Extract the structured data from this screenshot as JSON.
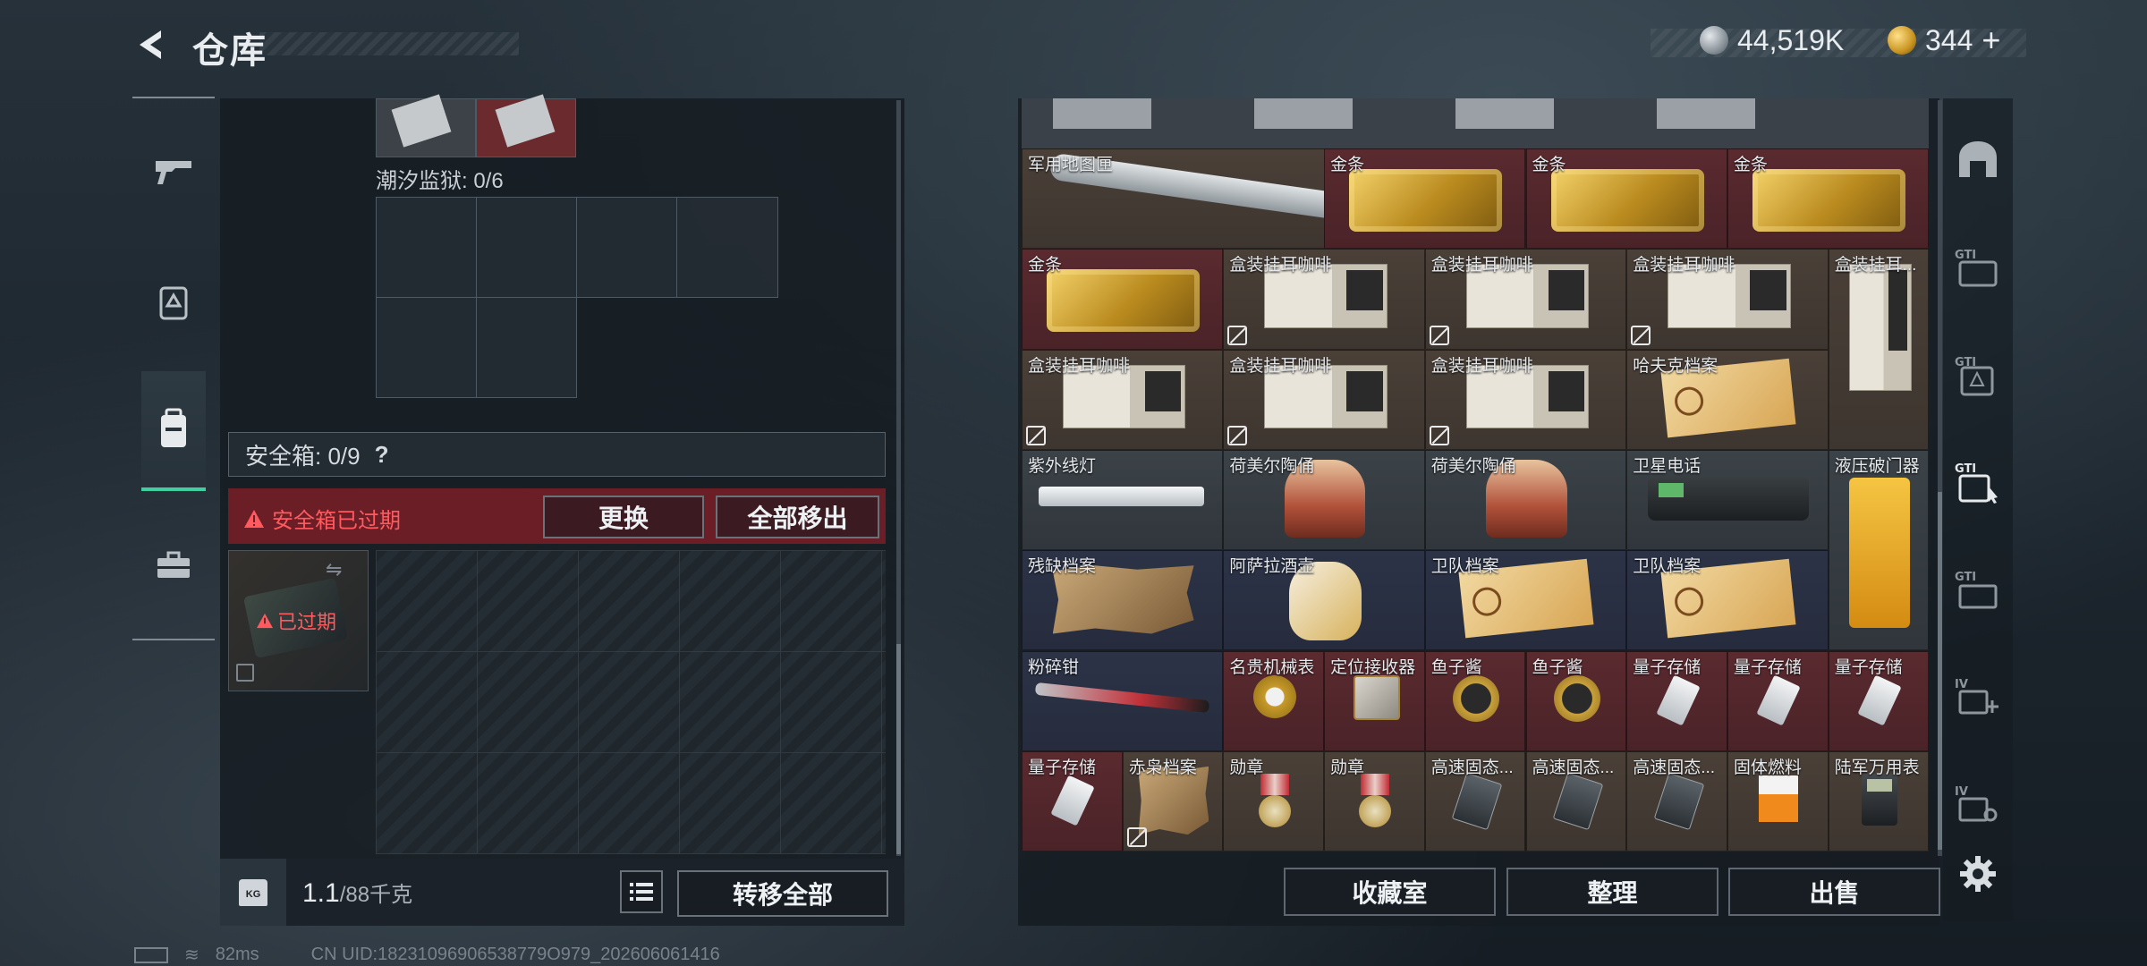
{
  "header": {
    "title": "仓库",
    "currency_silver": "44,519K",
    "currency_gold": "344",
    "gold_add": "+"
  },
  "left_nav": [
    "gun-icon",
    "backpack-icon",
    "rig-icon",
    "briefcase-icon"
  ],
  "left_panel": {
    "container_label": "潮汐监狱: 0/6",
    "safe_box_label": "安全箱: 0/9",
    "help": "?",
    "expired_notice": "安全箱已过期",
    "replace_button": "更换",
    "remove_all_button": "全部移出",
    "expired_badge": "已过期",
    "weight_value": "1.1",
    "weight_capacity": "/88千克",
    "weight_icon_text": "KG",
    "transfer_all_button": "转移全部"
  },
  "items": [
    {
      "name": "军用地图匣",
      "bg": "brown",
      "icon": "flashlight"
    },
    {
      "name": "金条",
      "bg": "red",
      "icon": "gold-bar"
    },
    {
      "name": "金条",
      "bg": "red",
      "icon": "gold-bar"
    },
    {
      "name": "金条",
      "bg": "red",
      "icon": "gold-bar"
    },
    {
      "name": "金条",
      "bg": "red",
      "icon": "gold-bar"
    },
    {
      "name": "盒装挂耳咖啡",
      "bg": "brown",
      "icon": "coffee-box"
    },
    {
      "name": "盒装挂耳咖啡",
      "bg": "brown",
      "icon": "coffee-box"
    },
    {
      "name": "盒装挂耳咖啡",
      "bg": "brown",
      "icon": "coffee-box"
    },
    {
      "name": "盒装挂耳...",
      "bg": "brown",
      "icon": "coffee-box"
    },
    {
      "name": "盒装挂耳咖啡",
      "bg": "brown",
      "icon": "coffee-box"
    },
    {
      "name": "盒装挂耳咖啡",
      "bg": "brown",
      "icon": "coffee-box"
    },
    {
      "name": "盒装挂耳咖啡",
      "bg": "brown",
      "icon": "coffee-box"
    },
    {
      "name": "哈夫克档案",
      "bg": "brown",
      "icon": "document"
    },
    {
      "name": "紫外线灯",
      "bg": "gray",
      "icon": "uv-lamp"
    },
    {
      "name": "荷美尔陶俑",
      "bg": "gray",
      "icon": "figurine"
    },
    {
      "name": "荷美尔陶俑",
      "bg": "gray",
      "icon": "figurine"
    },
    {
      "name": "卫星电话",
      "bg": "gray",
      "icon": "sat-phone"
    },
    {
      "name": "液压破门器",
      "bg": "gray",
      "icon": "hydraulic"
    },
    {
      "name": "残缺档案",
      "bg": "blue",
      "icon": "torn-doc"
    },
    {
      "name": "阿萨拉酒壶",
      "bg": "blue",
      "icon": "jug"
    },
    {
      "name": "卫队档案",
      "bg": "blue",
      "icon": "document"
    },
    {
      "name": "卫队档案",
      "bg": "blue",
      "icon": "document"
    },
    {
      "name": "粉碎钳",
      "bg": "blue",
      "icon": "cutter"
    },
    {
      "name": "名贵机械表",
      "bg": "red",
      "icon": "watch"
    },
    {
      "name": "定位接收器",
      "bg": "red",
      "icon": "receiver"
    },
    {
      "name": "鱼子酱",
      "bg": "red",
      "icon": "caviar"
    },
    {
      "name": "鱼子酱",
      "bg": "red",
      "icon": "caviar"
    },
    {
      "name": "量子存储",
      "bg": "red",
      "icon": "drive"
    },
    {
      "name": "量子存储",
      "bg": "red",
      "icon": "drive"
    },
    {
      "name": "量子存储",
      "bg": "red",
      "icon": "drive"
    },
    {
      "name": "量子存储",
      "bg": "red",
      "icon": "drive"
    },
    {
      "name": "赤枭档案",
      "bg": "brown",
      "icon": "torn-doc"
    },
    {
      "name": "勋章",
      "bg": "brown",
      "icon": "medal"
    },
    {
      "name": "勋章",
      "bg": "brown",
      "icon": "medal"
    },
    {
      "name": "高速固态...",
      "bg": "brown",
      "icon": "ssd"
    },
    {
      "name": "高速固态...",
      "bg": "brown",
      "icon": "ssd"
    },
    {
      "name": "高速固态...",
      "bg": "brown",
      "icon": "ssd"
    },
    {
      "name": "固体燃料",
      "bg": "brown",
      "icon": "fuel"
    },
    {
      "name": "陆军万用表",
      "bg": "brown",
      "icon": "multimeter"
    }
  ],
  "right_buttons": {
    "collection": "收藏室",
    "sort": "整理",
    "sell": "出售"
  },
  "right_nav": [
    "helmet-icon",
    "gti-1",
    "gti-2",
    "gti-3",
    "gti-4",
    "iv-1",
    "iv-2",
    "settings-icon"
  ],
  "status": {
    "ping": "82ms",
    "uid": "CN UID:18231096906538779O979_202606061416"
  },
  "colors": {
    "accent": "#3fd0a0",
    "expired_red": "#e0474c",
    "gold": "#d9a62a"
  }
}
